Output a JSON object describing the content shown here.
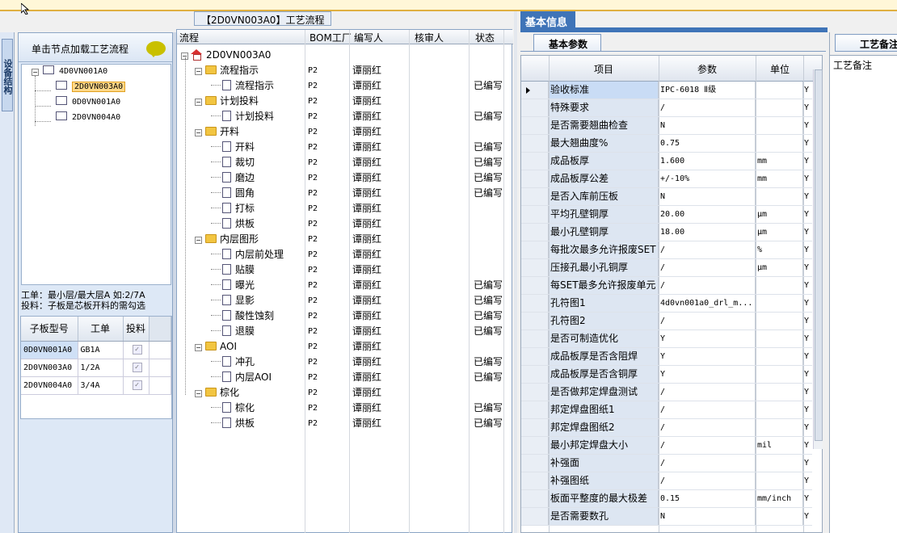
{
  "left_tab": {
    "label": "设备结构"
  },
  "left_panel": {
    "header": "单击节点加载工艺流程",
    "tree": [
      {
        "label": "4D0VN001A0",
        "level": 0,
        "expanded": true
      },
      {
        "label": "2D0VN003A0",
        "level": 1,
        "selected": true
      },
      {
        "label": "0D0VN001A0",
        "level": 1
      },
      {
        "label": "2D0VN004A0",
        "level": 1
      }
    ],
    "info_line1": "工单：最小层/最大层A 如:2/7A",
    "info_line2": "投料：子板是芯板开料的需勾选",
    "subboard_grid": {
      "headers": [
        "子板型号",
        "工单",
        "投料"
      ],
      "rows": [
        {
          "model": "0D0VN001A0",
          "order": "GB1A",
          "checked": true
        },
        {
          "model": "2D0VN003A0",
          "order": "1/2A",
          "checked": true
        },
        {
          "model": "2D0VN004A0",
          "order": "3/4A",
          "checked": true
        }
      ]
    }
  },
  "middle": {
    "title": "【2D0VN003A0】工艺流程",
    "headers": {
      "flow": "流程",
      "bom": "BOM工厂",
      "writer": "编写人",
      "reviewer": "核审人",
      "status": "状态"
    },
    "root": "2D0VN003A0",
    "rows": [
      {
        "name": "流程指示",
        "type": "folder",
        "bom": "P2",
        "writer": "谭丽红",
        "status": ""
      },
      {
        "name": "流程指示",
        "type": "doc",
        "bom": "P2",
        "writer": "谭丽红",
        "status": "已编写"
      },
      {
        "name": "计划投料",
        "type": "folder",
        "bom": "P2",
        "writer": "谭丽红",
        "status": ""
      },
      {
        "name": "计划投料",
        "type": "doc",
        "bom": "P2",
        "writer": "谭丽红",
        "status": "已编写"
      },
      {
        "name": "开料",
        "type": "folder",
        "bom": "P2",
        "writer": "谭丽红",
        "status": ""
      },
      {
        "name": "开料",
        "type": "doc",
        "bom": "P2",
        "writer": "谭丽红",
        "status": "已编写"
      },
      {
        "name": "裁切",
        "type": "doc",
        "bom": "P2",
        "writer": "谭丽红",
        "status": "已编写"
      },
      {
        "name": "磨边",
        "type": "doc",
        "bom": "P2",
        "writer": "谭丽红",
        "status": "已编写"
      },
      {
        "name": "圆角",
        "type": "doc",
        "bom": "P2",
        "writer": "谭丽红",
        "status": "已编写"
      },
      {
        "name": "打标",
        "type": "doc",
        "bom": "P2",
        "writer": "谭丽红",
        "status": ""
      },
      {
        "name": "烘板",
        "type": "doc",
        "bom": "P2",
        "writer": "谭丽红",
        "status": ""
      },
      {
        "name": "内层图形",
        "type": "folder",
        "bom": "P2",
        "writer": "谭丽红",
        "status": ""
      },
      {
        "name": "内层前处理",
        "type": "doc",
        "bom": "P2",
        "writer": "谭丽红",
        "status": ""
      },
      {
        "name": "贴膜",
        "type": "doc",
        "bom": "P2",
        "writer": "谭丽红",
        "status": ""
      },
      {
        "name": "曝光",
        "type": "doc",
        "bom": "P2",
        "writer": "谭丽红",
        "status": "已编写"
      },
      {
        "name": "显影",
        "type": "doc",
        "bom": "P2",
        "writer": "谭丽红",
        "status": "已编写"
      },
      {
        "name": "酸性蚀刻",
        "type": "doc",
        "bom": "P2",
        "writer": "谭丽红",
        "status": "已编写"
      },
      {
        "name": "退膜",
        "type": "doc",
        "bom": "P2",
        "writer": "谭丽红",
        "status": "已编写"
      },
      {
        "name": "AOI",
        "type": "folder",
        "bom": "P2",
        "writer": "谭丽红",
        "status": ""
      },
      {
        "name": "冲孔",
        "type": "doc",
        "bom": "P2",
        "writer": "谭丽红",
        "status": "已编写"
      },
      {
        "name": "内层AOI",
        "type": "doc",
        "bom": "P2",
        "writer": "谭丽红",
        "status": "已编写"
      },
      {
        "name": "棕化",
        "type": "folder",
        "bom": "P2",
        "writer": "谭丽红",
        "status": ""
      },
      {
        "name": "棕化",
        "type": "doc",
        "bom": "P2",
        "writer": "谭丽红",
        "status": "已编写"
      },
      {
        "name": "烘板",
        "type": "doc",
        "bom": "P2",
        "writer": "谭丽红",
        "status": "已编写"
      }
    ]
  },
  "right": {
    "top_tab": "基本信息",
    "sub_tab": "基本参数",
    "grid_headers": {
      "item": "项目",
      "param": "参数",
      "unit": "单位"
    },
    "rows": [
      {
        "item": "验收标准",
        "value": "IPC-6018 Ⅱ级",
        "unit": "",
        "y": "Y"
      },
      {
        "item": "特殊要求",
        "value": "/",
        "unit": "",
        "y": "Y"
      },
      {
        "item": "是否需要翘曲检查",
        "value": "N",
        "unit": "",
        "y": "Y"
      },
      {
        "item": "最大翘曲度%",
        "value": "0.75",
        "unit": "",
        "y": "Y"
      },
      {
        "item": "成品板厚",
        "value": "1.600",
        "unit": "mm",
        "y": "Y"
      },
      {
        "item": "成品板厚公差",
        "value": "+/-10%",
        "unit": "mm",
        "y": "Y"
      },
      {
        "item": "是否入库前压板",
        "value": "N",
        "unit": "",
        "y": "Y"
      },
      {
        "item": "平均孔壁铜厚",
        "value": "20.00",
        "unit": "μm",
        "y": "Y"
      },
      {
        "item": "最小孔壁铜厚",
        "value": "18.00",
        "unit": "μm",
        "y": "Y"
      },
      {
        "item": "每批次最多允许报废SET",
        "value": "/",
        "unit": "%",
        "y": "Y"
      },
      {
        "item": "压接孔最小孔铜厚",
        "value": "/",
        "unit": "μm",
        "y": "Y"
      },
      {
        "item": "每SET最多允许报废单元",
        "value": "/",
        "unit": "",
        "y": "Y"
      },
      {
        "item": "孔符图1",
        "value": "4d0vn001a0_drl_m...",
        "unit": "",
        "y": "Y"
      },
      {
        "item": "孔符图2",
        "value": "/",
        "unit": "",
        "y": "Y"
      },
      {
        "item": "是否可制造优化",
        "value": "Y",
        "unit": "",
        "y": "Y"
      },
      {
        "item": "成品板厚是否含阻焊",
        "value": "Y",
        "unit": "",
        "y": "Y"
      },
      {
        "item": "成品板厚是否含铜厚",
        "value": "Y",
        "unit": "",
        "y": "Y"
      },
      {
        "item": "是否做邦定焊盘测试",
        "value": "/",
        "unit": "",
        "y": "Y"
      },
      {
        "item": "邦定焊盘图纸1",
        "value": "/",
        "unit": "",
        "y": "Y"
      },
      {
        "item": "邦定焊盘图纸2",
        "value": "/",
        "unit": "",
        "y": "Y"
      },
      {
        "item": "最小邦定焊盘大小",
        "value": "/",
        "unit": "mil",
        "y": "Y"
      },
      {
        "item": "补强面",
        "value": "/",
        "unit": "",
        "y": "Y"
      },
      {
        "item": "补强图纸",
        "value": "/",
        "unit": "",
        "y": "Y"
      },
      {
        "item": "板面平整度的最大极差",
        "value": "0.15",
        "unit": "mm/inch",
        "y": "Y"
      },
      {
        "item": "是否需要数孔",
        "value": "N",
        "unit": "",
        "y": "Y"
      }
    ]
  },
  "far_right": {
    "tab": "工艺备注",
    "label": "工艺备注"
  }
}
